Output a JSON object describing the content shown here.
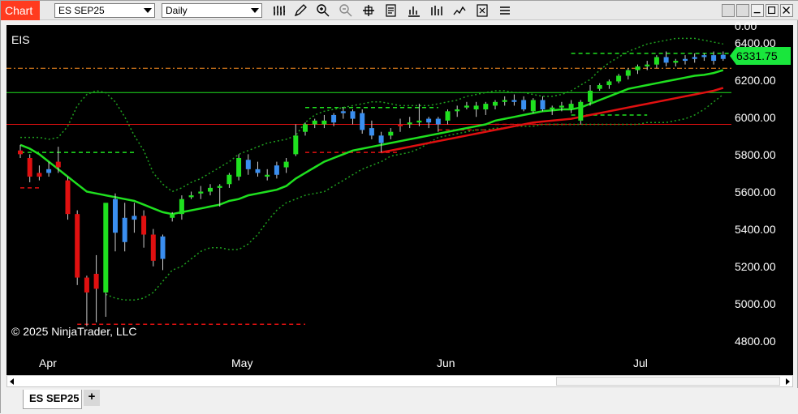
{
  "toolbar": {
    "chart_tab_label": "Chart",
    "instrument_select": "ES SEP25",
    "period_select": "Daily",
    "tools": [
      "bar-type-icon",
      "draw-pencil-icon",
      "zoom-in-icon",
      "zoom-out-icon",
      "crosshair-icon",
      "data-box-icon",
      "chart-style-icon",
      "indicators-icon",
      "strategies-icon",
      "properties-icon"
    ]
  },
  "window_controls": [
    "restore-down-icon",
    "minimize-icon",
    "maximize-icon",
    "close-icon"
  ],
  "chart": {
    "instrument_label": "EIS",
    "copyright": "© 2025 NinjaTrader, LLC",
    "last_price": "6331.75",
    "price_axis_labels": [
      "0.00",
      "6400.00",
      "6200.00",
      "6000.00",
      "5800.00",
      "5600.00",
      "5400.00",
      "5200.00",
      "5000.00",
      "4800.00"
    ],
    "month_labels": [
      "Apr",
      "May",
      "Jun",
      "Jul"
    ],
    "colors": {
      "background": "#000000",
      "up_candle": "#1fe01f",
      "down_candle": "#e01010",
      "sideways_candle": "#3a8ef0",
      "ma_fast": "#1fe01f",
      "ma_slow": "#e01010",
      "bands": "#1fa01f",
      "last_price_bg": "#19e63c"
    }
  },
  "chart_data": {
    "type": "candlestick",
    "ylim": [
      4720,
      6520
    ],
    "candles": [
      {
        "o": 5820,
        "h": 5850,
        "l": 5780,
        "c": 5800,
        "d": "down"
      },
      {
        "o": 5780,
        "h": 5800,
        "l": 5650,
        "c": 5680,
        "d": "down"
      },
      {
        "o": 5700,
        "h": 5740,
        "l": 5660,
        "c": 5680,
        "d": "down"
      },
      {
        "o": 5720,
        "h": 5760,
        "l": 5680,
        "c": 5700,
        "d": "side"
      },
      {
        "o": 5730,
        "h": 5840,
        "l": 5700,
        "c": 5760,
        "d": "down"
      },
      {
        "o": 5660,
        "h": 5680,
        "l": 5450,
        "c": 5480,
        "d": "down"
      },
      {
        "o": 5480,
        "h": 5500,
        "l": 5100,
        "c": 5140,
        "d": "down"
      },
      {
        "o": 5140,
        "h": 5150,
        "l": 4880,
        "c": 5060,
        "d": "down"
      },
      {
        "o": 5080,
        "h": 5260,
        "l": 4900,
        "c": 5160,
        "d": "down"
      },
      {
        "o": 5060,
        "h": 5530,
        "l": 4930,
        "c": 5540,
        "d": "up"
      },
      {
        "o": 5560,
        "h": 5590,
        "l": 5280,
        "c": 5380,
        "d": "side"
      },
      {
        "o": 5460,
        "h": 5540,
        "l": 5280,
        "c": 5330,
        "d": "side"
      },
      {
        "o": 5450,
        "h": 5540,
        "l": 5380,
        "c": 5470,
        "d": "side"
      },
      {
        "o": 5470,
        "h": 5500,
        "l": 5300,
        "c": 5370,
        "d": "down"
      },
      {
        "o": 5370,
        "h": 5400,
        "l": 5200,
        "c": 5230,
        "d": "down"
      },
      {
        "o": 5240,
        "h": 5370,
        "l": 5180,
        "c": 5360,
        "d": "side"
      },
      {
        "o": 5460,
        "h": 5490,
        "l": 5440,
        "c": 5480,
        "d": "up"
      },
      {
        "o": 5480,
        "h": 5580,
        "l": 5450,
        "c": 5560,
        "d": "up"
      },
      {
        "o": 5570,
        "h": 5600,
        "l": 5560,
        "c": 5580,
        "d": "up"
      },
      {
        "o": 5590,
        "h": 5630,
        "l": 5560,
        "c": 5600,
        "d": "up"
      },
      {
        "o": 5600,
        "h": 5640,
        "l": 5580,
        "c": 5620,
        "d": "up"
      },
      {
        "o": 5620,
        "h": 5640,
        "l": 5520,
        "c": 5630,
        "d": "up"
      },
      {
        "o": 5640,
        "h": 5700,
        "l": 5620,
        "c": 5690,
        "d": "up"
      },
      {
        "o": 5680,
        "h": 5800,
        "l": 5660,
        "c": 5780,
        "d": "up"
      },
      {
        "o": 5770,
        "h": 5800,
        "l": 5690,
        "c": 5720,
        "d": "side"
      },
      {
        "o": 5720,
        "h": 5760,
        "l": 5680,
        "c": 5700,
        "d": "side"
      },
      {
        "o": 5690,
        "h": 5720,
        "l": 5660,
        "c": 5680,
        "d": "up"
      },
      {
        "o": 5690,
        "h": 5760,
        "l": 5670,
        "c": 5740,
        "d": "side"
      },
      {
        "o": 5730,
        "h": 5780,
        "l": 5700,
        "c": 5760,
        "d": "up"
      },
      {
        "o": 5800,
        "h": 5960,
        "l": 5790,
        "c": 5900,
        "d": "up"
      },
      {
        "o": 5920,
        "h": 5970,
        "l": 5900,
        "c": 5960,
        "d": "up"
      },
      {
        "o": 5960,
        "h": 5990,
        "l": 5940,
        "c": 5980,
        "d": "up"
      },
      {
        "o": 5980,
        "h": 6010,
        "l": 5940,
        "c": 5960,
        "d": "up"
      },
      {
        "o": 5970,
        "h": 6020,
        "l": 5950,
        "c": 6010,
        "d": "side"
      },
      {
        "o": 6020,
        "h": 6050,
        "l": 5990,
        "c": 6030,
        "d": "side"
      },
      {
        "o": 6030,
        "h": 6040,
        "l": 5960,
        "c": 5990,
        "d": "side"
      },
      {
        "o": 6020,
        "h": 6040,
        "l": 5910,
        "c": 5930,
        "d": "side"
      },
      {
        "o": 5940,
        "h": 5980,
        "l": 5880,
        "c": 5900,
        "d": "side"
      },
      {
        "o": 5900,
        "h": 5920,
        "l": 5810,
        "c": 5860,
        "d": "side"
      },
      {
        "o": 5900,
        "h": 5940,
        "l": 5880,
        "c": 5920,
        "d": "up"
      },
      {
        "o": 5950,
        "h": 5990,
        "l": 5920,
        "c": 5960,
        "d": "down"
      },
      {
        "o": 5960,
        "h": 6000,
        "l": 5940,
        "c": 5970,
        "d": "up"
      },
      {
        "o": 5970,
        "h": 6070,
        "l": 5950,
        "c": 5980,
        "d": "up"
      },
      {
        "o": 5990,
        "h": 6000,
        "l": 5940,
        "c": 5970,
        "d": "side"
      },
      {
        "o": 5960,
        "h": 6000,
        "l": 5920,
        "c": 5990,
        "d": "side"
      },
      {
        "o": 5980,
        "h": 6040,
        "l": 5960,
        "c": 6030,
        "d": "up"
      },
      {
        "o": 6030,
        "h": 6060,
        "l": 6000,
        "c": 6040,
        "d": "up"
      },
      {
        "o": 6050,
        "h": 6080,
        "l": 6040,
        "c": 6060,
        "d": "up"
      },
      {
        "o": 6060,
        "h": 6080,
        "l": 6000,
        "c": 6040,
        "d": "up"
      },
      {
        "o": 6040,
        "h": 6080,
        "l": 6010,
        "c": 6070,
        "d": "up"
      },
      {
        "o": 6060,
        "h": 6090,
        "l": 6040,
        "c": 6080,
        "d": "up"
      },
      {
        "o": 6080,
        "h": 6110,
        "l": 6060,
        "c": 6090,
        "d": "up"
      },
      {
        "o": 6090,
        "h": 6120,
        "l": 6060,
        "c": 6080,
        "d": "side"
      },
      {
        "o": 6090,
        "h": 6110,
        "l": 6030,
        "c": 6040,
        "d": "side"
      },
      {
        "o": 6030,
        "h": 6100,
        "l": 6020,
        "c": 6090,
        "d": "up"
      },
      {
        "o": 6090,
        "h": 6110,
        "l": 6030,
        "c": 6040,
        "d": "side"
      },
      {
        "o": 6040,
        "h": 6060,
        "l": 6010,
        "c": 6050,
        "d": "up"
      },
      {
        "o": 6050,
        "h": 6080,
        "l": 6030,
        "c": 6060,
        "d": "up"
      },
      {
        "o": 6040,
        "h": 6090,
        "l": 6020,
        "c": 6070,
        "d": "up"
      },
      {
        "o": 5980,
        "h": 6090,
        "l": 5960,
        "c": 6080,
        "d": "up"
      },
      {
        "o": 6080,
        "h": 6170,
        "l": 6060,
        "c": 6140,
        "d": "up"
      },
      {
        "o": 6150,
        "h": 6180,
        "l": 6140,
        "c": 6170,
        "d": "up"
      },
      {
        "o": 6170,
        "h": 6200,
        "l": 6150,
        "c": 6190,
        "d": "up"
      },
      {
        "o": 6190,
        "h": 6230,
        "l": 6180,
        "c": 6220,
        "d": "up"
      },
      {
        "o": 6220,
        "h": 6260,
        "l": 6200,
        "c": 6250,
        "d": "up"
      },
      {
        "o": 6250,
        "h": 6280,
        "l": 6230,
        "c": 6270,
        "d": "up"
      },
      {
        "o": 6270,
        "h": 6300,
        "l": 6250,
        "c": 6280,
        "d": "up"
      },
      {
        "o": 6280,
        "h": 6330,
        "l": 6260,
        "c": 6320,
        "d": "up"
      },
      {
        "o": 6320,
        "h": 6350,
        "l": 6270,
        "c": 6290,
        "d": "side"
      },
      {
        "o": 6290,
        "h": 6310,
        "l": 6270,
        "c": 6300,
        "d": "up"
      },
      {
        "o": 6300,
        "h": 6330,
        "l": 6280,
        "c": 6310,
        "d": "side"
      },
      {
        "o": 6310,
        "h": 6340,
        "l": 6290,
        "c": 6320,
        "d": "side"
      },
      {
        "o": 6320,
        "h": 6340,
        "l": 6300,
        "c": 6330,
        "d": "side"
      },
      {
        "o": 6330,
        "h": 6350,
        "l": 6280,
        "c": 6300,
        "d": "side"
      },
      {
        "o": 6310,
        "h": 6350,
        "l": 6300,
        "c": 6332,
        "d": "side"
      }
    ],
    "horizontal_lines": [
      {
        "price": 6260,
        "color": "#ff9020",
        "style": "dash-dot"
      },
      {
        "price": 6130,
        "color": "#1fe01f",
        "style": "solid"
      },
      {
        "price": 5960,
        "color": "#e01010",
        "style": "solid"
      }
    ],
    "ma_fast": [
      5850,
      5830,
      5800,
      5760,
      5720,
      5680,
      5640,
      5600,
      5590,
      5580,
      5570,
      5560,
      5550,
      5530,
      5510,
      5490,
      5480,
      5490,
      5500,
      5510,
      5520,
      5530,
      5550,
      5560,
      5580,
      5590,
      5600,
      5610,
      5630,
      5670,
      5700,
      5730,
      5760,
      5780,
      5800,
      5820,
      5830,
      5840,
      5850,
      5860,
      5870,
      5880,
      5890,
      5900,
      5910,
      5920,
      5930,
      5940,
      5950,
      5960,
      5980,
      5990,
      6000,
      6010,
      6020,
      6030,
      6035,
      6040,
      6040,
      6050,
      6070,
      6090,
      6110,
      6130,
      6150,
      6160,
      6170,
      6180,
      6190,
      6200,
      6210,
      6220,
      6225,
      6235,
      6250
    ],
    "ma_slow": [
      null,
      null,
      null,
      null,
      null,
      null,
      null,
      null,
      null,
      null,
      null,
      null,
      null,
      null,
      null,
      null,
      null,
      null,
      null,
      null,
      null,
      null,
      null,
      null,
      null,
      null,
      null,
      null,
      null,
      null,
      null,
      null,
      null,
      null,
      null,
      null,
      null,
      null,
      5810,
      5820,
      5830,
      5840,
      5850,
      5860,
      5870,
      5880,
      5890,
      5900,
      5910,
      5920,
      5930,
      5940,
      5950,
      5960,
      5970,
      5975,
      5980,
      5985,
      5990,
      6000,
      6010,
      6020,
      6030,
      6040,
      6050,
      6060,
      6070,
      6080,
      6090,
      6100,
      6110,
      6120,
      6130,
      6140,
      6155
    ],
    "band_upper": [
      5890,
      5890,
      5890,
      5880,
      5890,
      5950,
      6060,
      6120,
      6140,
      6130,
      6080,
      6000,
      5900,
      5820,
      5700,
      5640,
      5600,
      5620,
      5650,
      5670,
      5700,
      5730,
      5760,
      5800,
      5820,
      5840,
      5860,
      5870,
      5880,
      5900,
      5970,
      6010,
      6030,
      6040,
      6050,
      6060,
      6070,
      6080,
      6080,
      6070,
      6060,
      6060,
      6060,
      6060,
      6070,
      6080,
      6090,
      6110,
      6120,
      6130,
      6140,
      6140,
      6130,
      6130,
      6120,
      6110,
      6110,
      6120,
      6140,
      6170,
      6200,
      6250,
      6290,
      6320,
      6350,
      6370,
      6390,
      6400,
      6410,
      6420,
      6420,
      6420,
      6410,
      6400,
      6390
    ],
    "band_lower": [
      null,
      null,
      null,
      null,
      null,
      null,
      null,
      null,
      null,
      5050,
      5030,
      5020,
      5020,
      5030,
      5060,
      5120,
      5180,
      5200,
      5240,
      5280,
      5300,
      5300,
      5290,
      5290,
      5320,
      5370,
      5440,
      5500,
      5540,
      5560,
      5580,
      5590,
      5600,
      5630,
      5660,
      5690,
      5720,
      5740,
      5760,
      5790,
      5800,
      5810,
      5830,
      5860,
      5890,
      5900,
      5910,
      5920,
      5930,
      5930,
      5940,
      5940,
      5950,
      5950,
      5950,
      5960,
      5960,
      5960,
      5960,
      5960,
      5960,
      5960,
      5960,
      5960,
      5960,
      5960,
      5970,
      5970,
      5970,
      5980,
      5990,
      6010,
      6040,
      6080,
      6120
    ],
    "dashed_levels": [
      {
        "price": 5810,
        "from": 0,
        "to": 12,
        "color": "#1fe01f"
      },
      {
        "price": 5620,
        "from": 0,
        "to": 2,
        "color": "#e01010"
      },
      {
        "price": 4890,
        "from": 6,
        "to": 30,
        "color": "#e01010"
      },
      {
        "price": 5810,
        "from": 30,
        "to": 40,
        "color": "#e01010"
      },
      {
        "price": 6050,
        "from": 30,
        "to": 44,
        "color": "#1fe01f"
      },
      {
        "price": 5930,
        "from": 44,
        "to": 50,
        "color": "#e01010"
      },
      {
        "price": 5960,
        "from": 50,
        "to": 58,
        "color": "#e01010"
      },
      {
        "price": 6010,
        "from": 58,
        "to": 66,
        "color": "#1fe01f"
      },
      {
        "price": 6340,
        "from": 58,
        "to": 75,
        "color": "#1fe01f"
      }
    ]
  },
  "tabs": {
    "active": "ES SEP25",
    "add_label": "+"
  }
}
